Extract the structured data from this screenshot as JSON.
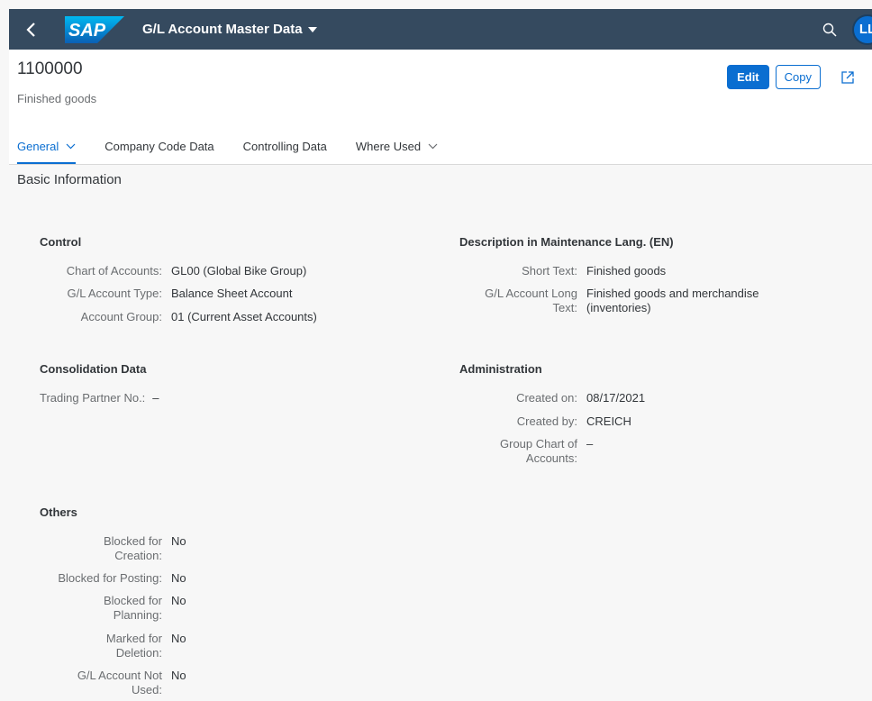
{
  "shell": {
    "logo_text": "SAP",
    "app_title": "G/L Account Master Data",
    "avatar_initials": "LL",
    "icons": [
      "back-icon",
      "search-icon",
      "caret-down-icon"
    ]
  },
  "header": {
    "title": "1100000",
    "subtitle": "Finished goods",
    "edit_label": "Edit",
    "copy_label": "Copy",
    "share_icon": "share-icon"
  },
  "tabs": [
    {
      "label": "General",
      "active": true,
      "has_dropdown": true
    },
    {
      "label": "Company Code Data",
      "active": false,
      "has_dropdown": false
    },
    {
      "label": "Controlling Data",
      "active": false,
      "has_dropdown": false
    },
    {
      "label": "Where Used",
      "active": false,
      "has_dropdown": true
    }
  ],
  "section": {
    "title": "Basic Information"
  },
  "control": {
    "title": "Control",
    "fields": [
      {
        "label": "Chart of Accounts:",
        "value": "GL00 (Global Bike Group)"
      },
      {
        "label": "G/L Account Type:",
        "value": "Balance Sheet Account"
      },
      {
        "label": "Account Group:",
        "value": "01 (Current Asset Accounts)"
      }
    ]
  },
  "description": {
    "title": "Description in Maintenance Lang. (EN)",
    "fields": [
      {
        "label": "Short Text:",
        "value": "Finished goods"
      },
      {
        "label_line1": "G/L Account Long",
        "label_line2": "Text:",
        "value_line1": "Finished goods and merchandise",
        "value_line2": "(inventories)"
      }
    ]
  },
  "consolidation": {
    "title": "Consolidation Data",
    "fields": [
      {
        "label": "Trading Partner No.:",
        "value": "–"
      }
    ]
  },
  "administration": {
    "title": "Administration",
    "fields": [
      {
        "label": "Created on:",
        "value": "08/17/2021"
      },
      {
        "label": "Created by:",
        "value": "CREICH"
      },
      {
        "label_line1": "Group Chart of",
        "label_line2": "Accounts:",
        "value": "–"
      }
    ]
  },
  "others": {
    "title": "Others",
    "fields": [
      {
        "label_line1": "Blocked for",
        "label_line2": "Creation:",
        "value": "No"
      },
      {
        "label": "Blocked for Posting:",
        "value": "No"
      },
      {
        "label_line1": "Blocked for",
        "label_line2": "Planning:",
        "value": "No"
      },
      {
        "label_line1": "Marked for",
        "label_line2": "Deletion:",
        "value": "No"
      },
      {
        "label_line1": "G/L Account Not",
        "label_line2": "Used:",
        "value": "No"
      }
    ]
  },
  "colors": {
    "shell_bg": "#354a5f",
    "accent": "#0a6ed1",
    "label": "#6a6d70",
    "text": "#32363a"
  }
}
